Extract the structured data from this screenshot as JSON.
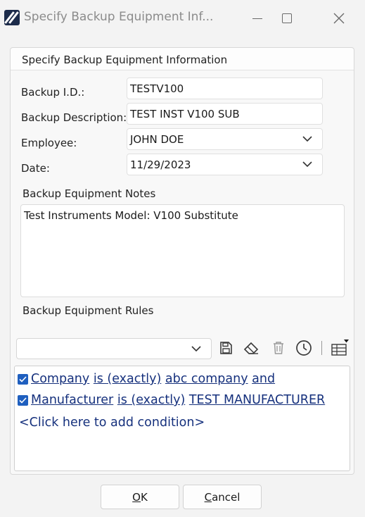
{
  "window": {
    "title": "Specify Backup Equipment Inf...",
    "icon": "app-logo-icon",
    "controls": [
      "minimize-icon",
      "maximize-icon",
      "close-icon"
    ]
  },
  "panel": {
    "header": "Specify Backup Equipment Information"
  },
  "form": {
    "backup_id_label": "Backup I.D.:",
    "backup_id_value": "TESTV100",
    "description_label": "Backup Description:",
    "description_value": "TEST INST V100 SUB",
    "employee_label": "Employee:",
    "employee_value": "JOHN DOE",
    "date_label": "Date:",
    "date_value": "11/29/2023"
  },
  "notes": {
    "label": "Backup Equipment Notes",
    "value": "Test Instruments Model: V100 Substitute"
  },
  "rules": {
    "label": "Backup Equipment Rules",
    "selected": "",
    "toolbar_icons": [
      "save-icon",
      "eraser-icon",
      "delete-icon",
      "history-icon",
      "table-options-icon"
    ],
    "conditions": [
      {
        "field": "Company",
        "operator": "is (exactly)",
        "value": "abc company",
        "joiner": "and",
        "checked": true
      },
      {
        "field": "Manufacturer",
        "operator": "is (exactly)",
        "value": "TEST MANUFACTURER",
        "joiner": "",
        "checked": true
      }
    ],
    "add_condition": "<Click here to add condition>"
  },
  "buttons": {
    "ok_first": "O",
    "ok_rest": "K",
    "cancel_first": "C",
    "cancel_rest": "ancel"
  },
  "colors": {
    "link": "#16317d",
    "checkbox": "#1f5fbf",
    "app_icon": "#1c2b4a"
  }
}
